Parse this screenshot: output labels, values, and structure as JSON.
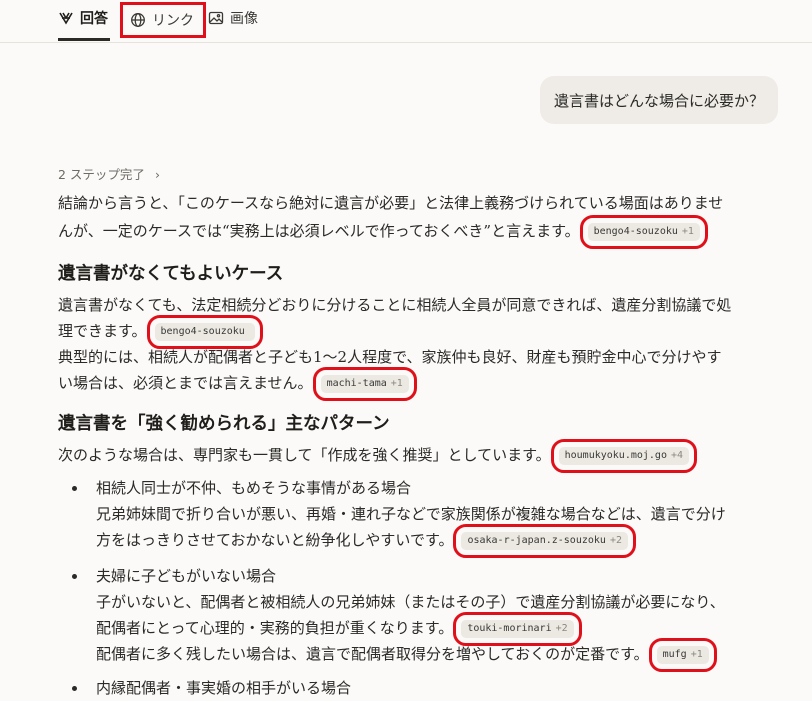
{
  "tabs": [
    {
      "label": "回答",
      "icon": "answer-icon"
    },
    {
      "label": "リンク",
      "icon": "globe-icon"
    },
    {
      "label": "画像",
      "icon": "image-icon"
    }
  ],
  "question": "遺言書はどんな場合に必要か？",
  "steps_label": "2 ステップ完了",
  "answer": {
    "intro_1": "結論から言うと、「このケースなら絶対に遺言が必要」と法律上義務づけられている場面はありませ",
    "intro_2": "んが、一定のケースでは“実務上は必須レベルで作っておくべき”と言えます。",
    "chip_1": {
      "domain": "bengo4-souzoku",
      "more": "+1"
    },
    "heading_1": "遺言書がなくてもよいケース",
    "case_1a": "遺言書がなくても、法定相続分どおりに分けることに相続人全員が同意できれば、遺産分割協議で処",
    "case_1b": "理できます。",
    "chip_2": {
      "domain": "bengo4-souzoku",
      "more": ""
    },
    "case_2a": "典型的には、相続人が配偶者と子ども1～2人程度で、家族仲も良好、財産も預貯金中心で分けやす",
    "case_2b": "い場合は、必須とまでは言えません。",
    "chip_3": {
      "domain": "machi-tama",
      "more": "+1"
    },
    "heading_2": "遺言書を「強く勧められる」主なパターン",
    "pattern_intro": "次のような場合は、専門家も一貫して「作成を強く推奨」としています。",
    "chip_4": {
      "domain": "houmukyoku.moj.go",
      "more": "+4"
    },
    "bullet_1_title": "相続人同士が不仲、もめそうな事情がある場合",
    "bullet_1_a": "兄弟姉妹間で折り合いが悪い、再婚・連れ子などで家族関係が複雑な場合などは、遺言で分け",
    "bullet_1_b": "方をはっきりさせておかないと紛争化しやすいです。",
    "chip_5": {
      "domain": "osaka-r-japan.z-souzoku",
      "more": "+2"
    },
    "bullet_2_title": "夫婦に子どもがいない場合",
    "bullet_2_a": "子がいないと、配偶者と被相続人の兄弟姉妹（またはその子）で遺産分割協議が必要になり、",
    "bullet_2_b": "配偶者にとって心理的・実務的負担が重くなります。",
    "chip_6": {
      "domain": "touki-morinari",
      "more": "+2"
    },
    "bullet_2_c": "配偶者に多く残したい場合は、遺言で配偶者取得分を増やしておくのが定番です。",
    "chip_7": {
      "domain": "mufg",
      "more": "+1"
    },
    "bullet_3_title": "内縁配偶者・事実婚の相手がいる場合"
  },
  "colors": {
    "highlight": "#e0101a",
    "background": "#fbfaf8",
    "bubble": "#efece7",
    "chip": "#ece9e3"
  }
}
